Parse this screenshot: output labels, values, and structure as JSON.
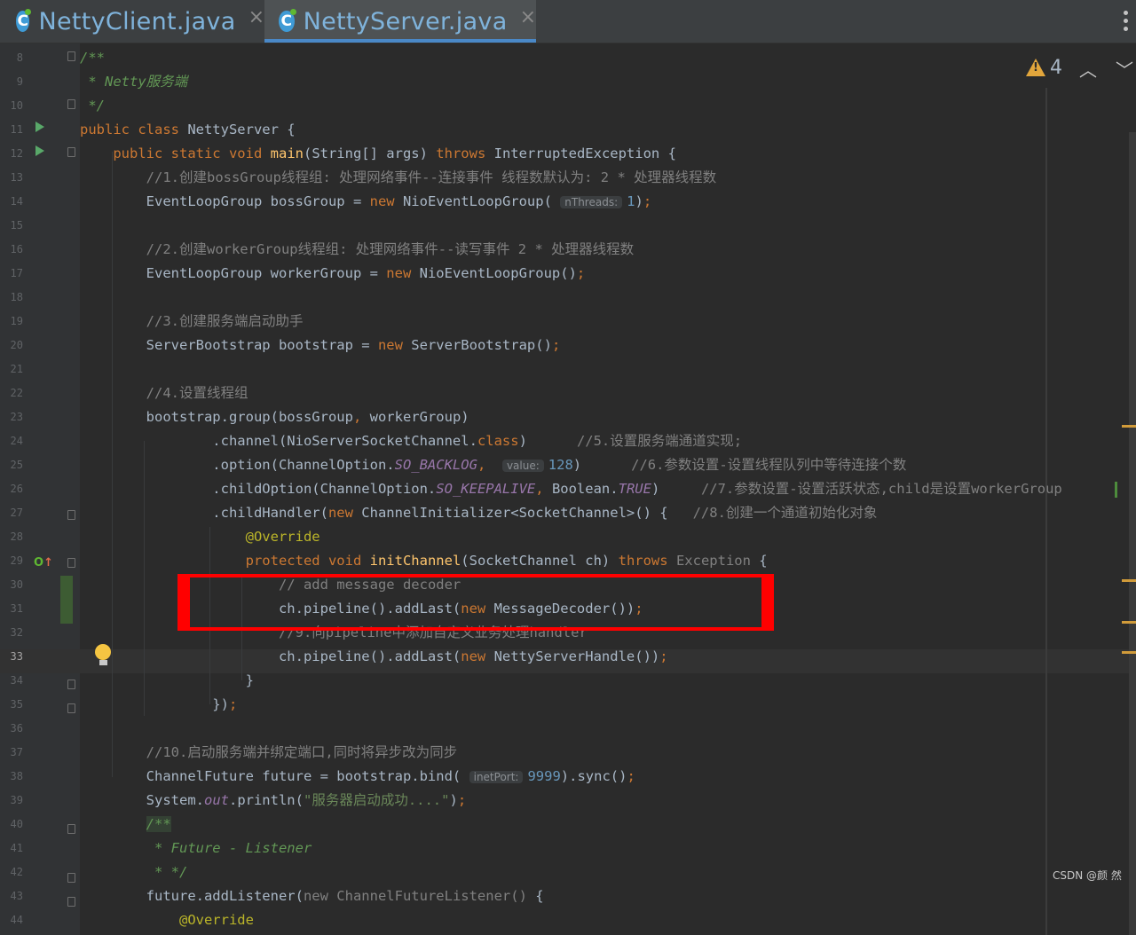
{
  "tabs": [
    {
      "label": "NettyClient.java",
      "icon": "java-class-icon",
      "close": "×",
      "active": false
    },
    {
      "label": "NettyServer.java",
      "icon": "java-class-icon",
      "close": "×",
      "active": true
    }
  ],
  "inspection": {
    "warning_count": "4"
  },
  "watermark": "CSDN @颜 然",
  "editor": {
    "current_line": "33",
    "lines": [
      {
        "n": "8",
        "html": "<span class='doc'>/**</span>"
      },
      {
        "n": "9",
        "html": "<span class='doc'> * Netty服务端</span>"
      },
      {
        "n": "10",
        "html": "<span class='doc'> */</span>"
      },
      {
        "n": "11",
        "html": "<span class='kw'>public class</span> NettyServer {"
      },
      {
        "n": "12",
        "html": "    <span class='kw'>public static void</span> <span class='fn'>main</span>(String[] args) <span class='kw'>throws</span> InterruptedException {"
      },
      {
        "n": "13",
        "html": "        <span class='cm'>//1.创建bossGroup线程组: 处理网络事件--连接事件 线程数默认为: 2 * 处理器线程数</span>"
      },
      {
        "n": "14",
        "html": "        EventLoopGroup bossGroup = <span class='kw'>new</span> NioEventLoopGroup( <span class='hint'>nThreads:</span><span class='num'>1</span>)<span class='kw'>;</span>"
      },
      {
        "n": "15",
        "html": ""
      },
      {
        "n": "16",
        "html": "        <span class='cm'>//2.创建workerGroup线程组: 处理网络事件--读写事件 2 * 处理器线程数</span>"
      },
      {
        "n": "17",
        "html": "        EventLoopGroup workerGroup = <span class='kw'>new</span> NioEventLoopGroup()<span class='kw'>;</span>"
      },
      {
        "n": "18",
        "html": ""
      },
      {
        "n": "19",
        "html": "        <span class='cm'>//3.创建服务端启动助手</span>"
      },
      {
        "n": "20",
        "html": "        ServerBootstrap bootstrap = <span class='kw'>new</span> ServerBootstrap()<span class='kw'>;</span>"
      },
      {
        "n": "21",
        "html": ""
      },
      {
        "n": "22",
        "html": "        <span class='cm'>//4.设置线程组</span>"
      },
      {
        "n": "23",
        "html": "        bootstrap.group(bossGroup<span class='kw'>,</span> workerGroup)"
      },
      {
        "n": "24",
        "html": "                .channel(NioServerSocketChannel.<span class='kw'>class</span>)      <span class='cm'>//5.设置服务端通道实现;</span>"
      },
      {
        "n": "25",
        "html": "                .option(ChannelOption.<span class='st'>SO_BACKLOG</span><span class='kw'>,</span>  <span class='hint'>value:</span><span class='num'>128</span>)      <span class='cm'>//6.参数设置-设置线程队列中等待连接个数</span>"
      },
      {
        "n": "26",
        "html": "                .childOption(ChannelOption.<span class='st'>SO_KEEPALIVE</span><span class='kw'>,</span> Boolean.<span class='st'>TRUE</span>)     <span class='cm'>//7.参数设置-设置活跃状态,child是设置workerGroup</span>"
      },
      {
        "n": "27",
        "html": "                .childHandler(<span class='kw'>new</span> ChannelInitializer&lt;SocketChannel&gt;() {   <span class='cm'>//8.创建一个通道初始化对象</span>"
      },
      {
        "n": "28",
        "html": "                    <span class='an'>@Override</span>"
      },
      {
        "n": "29",
        "html": "                    <span class='kw'>protected void</span> <span class='fn'>initChannel</span>(SocketChannel ch) <span class='kw'>throws</span> <span class='cm'>Exception</span> {"
      },
      {
        "n": "30",
        "html": "                        <span class='cm'>// add message decoder</span>"
      },
      {
        "n": "31",
        "html": "                        ch.pipeline().addLast(<span class='kw'>new</span> MessageDecoder())<span class='kw'>;</span>"
      },
      {
        "n": "32",
        "html": "                        <span class='cm'>//9.向pipeline中添加自定义业务处理handler</span>"
      },
      {
        "n": "33",
        "html": "                        ch.pipeline().addLast(<span class='kw'>new</span> NettyServerHandle())<span class='kw'>;</span>"
      },
      {
        "n": "34",
        "html": "                    }"
      },
      {
        "n": "35",
        "html": "                })<span class='kw'>;</span>"
      },
      {
        "n": "36",
        "html": ""
      },
      {
        "n": "37",
        "html": "        <span class='cm'>//10.启动服务端并绑定端口,同时将异步改为同步</span>"
      },
      {
        "n": "38",
        "html": "        ChannelFuture future = bootstrap.bind( <span class='hint'>inetPort:</span><span class='num'>9999</span>).sync()<span class='kw'>;</span>"
      },
      {
        "n": "39",
        "html": "        System.<span class='st'>out</span>.println(<span class='str'>\"服务器启动成功....\"</span>)<span class='kw'>;</span>"
      },
      {
        "n": "40",
        "html": "        <span class='doc' style='background:#344134'>/**</span>"
      },
      {
        "n": "41",
        "html": "<span class='doc'>         * Future - Listener</span>"
      },
      {
        "n": "42",
        "html": "<span class='doc'>         * */</span>"
      },
      {
        "n": "43",
        "html": "        future.addListener(<span class='cm'>new ChannelFutureListener()</span> {"
      },
      {
        "n": "44",
        "html": "            <span class='an'>@Override</span>"
      }
    ]
  }
}
